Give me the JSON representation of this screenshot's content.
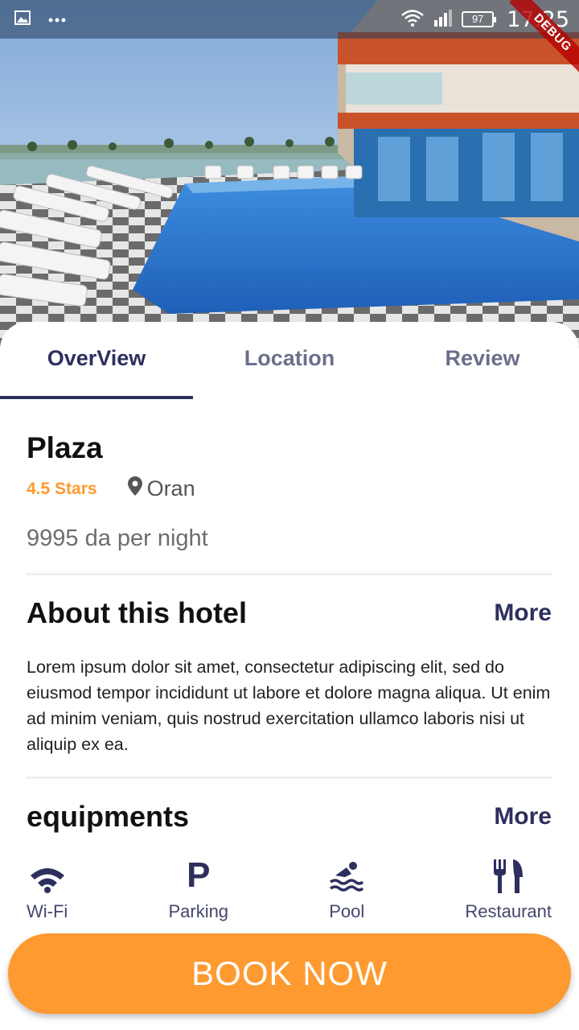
{
  "status_bar": {
    "battery": "97",
    "time": "17:25",
    "debug_label": "DEBUG"
  },
  "tabs": [
    {
      "label": "OverView"
    },
    {
      "label": "Location"
    },
    {
      "label": "Review"
    }
  ],
  "hotel": {
    "name": "Plaza",
    "stars": "4.5 Stars",
    "location": "Oran",
    "price": "9995 da per night"
  },
  "about": {
    "title": "About this hotel",
    "more_label": "More",
    "text": "Lorem ipsum dolor sit amet, consectetur adipiscing elit, sed do eiusmod tempor incididunt ut labore et dolore magna aliqua. Ut enim ad minim veniam, quis nostrud exercitation ullamco laboris nisi ut aliquip ex ea."
  },
  "equipments": {
    "title": "equipments",
    "more_label": "More",
    "items": [
      {
        "label": "Wi-Fi",
        "icon": "wifi-icon"
      },
      {
        "label": "Parking",
        "icon": "parking-icon",
        "glyph": "P"
      },
      {
        "label": "Pool",
        "icon": "pool-icon"
      },
      {
        "label": "Restaurant",
        "icon": "restaurant-icon"
      }
    ]
  },
  "book_button": {
    "label": "BOOK NOW"
  },
  "colors": {
    "accent": "#ff9a30",
    "primary": "#2d2f5e"
  }
}
